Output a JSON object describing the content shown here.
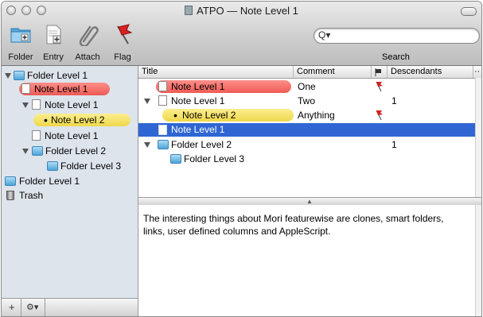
{
  "window": {
    "title": "ATPO — Note Level 1"
  },
  "toolbar": {
    "folder_label": "Folder",
    "entry_label": "Entry",
    "attach_label": "Attach",
    "flag_label": "Flag",
    "search_label": "Search",
    "search_value": ""
  },
  "sidebar": {
    "items": [
      {
        "label": "Folder Level 1",
        "kind": "folder",
        "expanded": true
      },
      {
        "label": "Note Level 1",
        "kind": "note",
        "color_label": "red"
      },
      {
        "label": "Note Level 1",
        "kind": "note",
        "expanded": true
      },
      {
        "label": "Note Level 2",
        "kind": "bullet",
        "color_label": "yellow"
      },
      {
        "label": "Note Level 1",
        "kind": "note"
      },
      {
        "label": "Folder Level 2",
        "kind": "folder",
        "expanded": true
      },
      {
        "label": "Folder Level 3",
        "kind": "folder"
      },
      {
        "label": "Folder Level 1",
        "kind": "folder"
      },
      {
        "label": "Trash",
        "kind": "trash"
      }
    ],
    "footer": {
      "add": "+",
      "action": "⚙▾"
    }
  },
  "outline": {
    "columns": [
      "Title",
      "Comment",
      "",
      "Descendants"
    ],
    "rows": [
      {
        "title": "Note Level 1",
        "comment": "One",
        "flag": true,
        "descendants": "",
        "color_label": "red"
      },
      {
        "title": "Note Level 1",
        "comment": "Two",
        "flag": false,
        "descendants": "1",
        "expanded": true
      },
      {
        "title": "Note Level 2",
        "comment": "Anything",
        "flag": true,
        "descendants": "",
        "color_label": "yellow"
      },
      {
        "title": "Note Level 1",
        "comment": "",
        "flag": false,
        "descendants": "",
        "selected": true
      },
      {
        "title": "Folder Level 2",
        "comment": "",
        "flag": false,
        "descendants": "1",
        "expanded": true
      },
      {
        "title": "Folder Level 3",
        "comment": "",
        "flag": false,
        "descendants": ""
      }
    ]
  },
  "editor": {
    "text": "The interesting things about Mori featurewise are clones, smart folders, links, user defined columns and AppleScript."
  },
  "colors": {
    "selection": "#2f66d3",
    "label_red": "#ef5a55",
    "label_yellow": "#efd84a",
    "sidebar_bg": "#dde4ec",
    "flag_red": "#d42020"
  }
}
